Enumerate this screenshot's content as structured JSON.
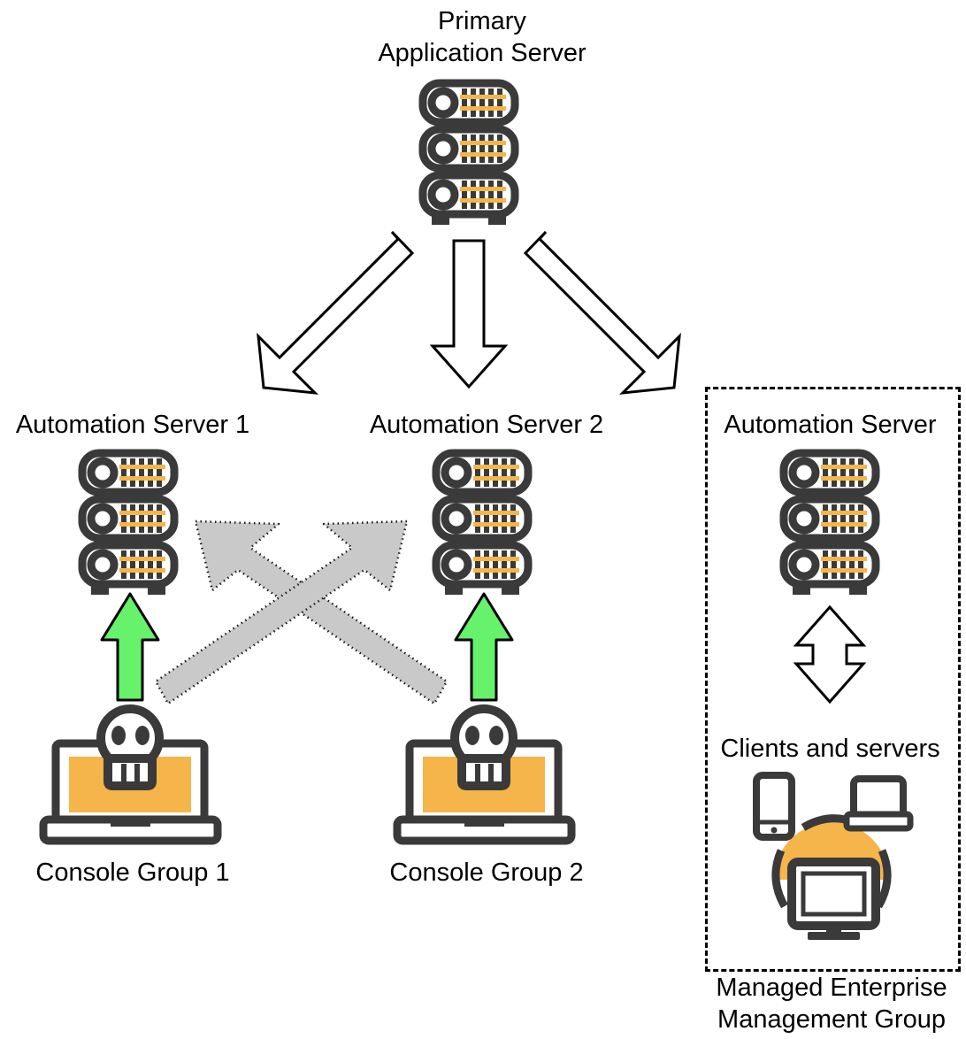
{
  "diagram": {
    "title_top": "Primary\nApplication Server",
    "nodes": {
      "primary_server": {
        "label": "Primary\nApplication Server",
        "icon": "server-rack-icon"
      },
      "automation_server_1": {
        "label": "Automation Server 1",
        "icon": "server-rack-icon"
      },
      "automation_server_2": {
        "label": "Automation Server 2",
        "icon": "server-rack-icon"
      },
      "automation_server_3": {
        "label": "Automation Server",
        "icon": "server-rack-icon"
      },
      "console_group_1": {
        "label": "Console Group 1",
        "icon": "laptop-skull-icon"
      },
      "console_group_2": {
        "label": "Console Group 2",
        "icon": "laptop-skull-icon"
      },
      "clients_and_servers": {
        "label": "Clients and servers",
        "icon": "devices-cluster-icon"
      },
      "managed_group": {
        "label": "Managed Enterprise\nManagement Group"
      }
    },
    "connectors": [
      {
        "name": "primary-to-automation-1",
        "style": "hollow-block-arrow",
        "direction": "down-left"
      },
      {
        "name": "primary-to-automation-2",
        "style": "hollow-block-arrow",
        "direction": "down"
      },
      {
        "name": "primary-to-automation-3",
        "style": "hollow-block-arrow",
        "direction": "down-right"
      },
      {
        "name": "console-1-to-automation-1",
        "style": "solid-green-arrow",
        "direction": "up"
      },
      {
        "name": "console-2-to-automation-2",
        "style": "solid-green-arrow",
        "direction": "up"
      },
      {
        "name": "console-2-to-automation-1",
        "style": "gray-dotted-arrow",
        "direction": "up-left"
      },
      {
        "name": "console-1-to-automation-2",
        "style": "gray-dotted-arrow",
        "direction": "up-right"
      },
      {
        "name": "automation-3-to-clients",
        "style": "hollow-double-arrow",
        "direction": "vertical"
      }
    ],
    "colors": {
      "icon_dark": "#3A3A3A",
      "icon_orange": "#F5B54A",
      "green_arrow": "#66F26B",
      "gray_arrow": "#C9C9C9",
      "outline_black": "#000000",
      "background": "#FFFFFF"
    }
  }
}
